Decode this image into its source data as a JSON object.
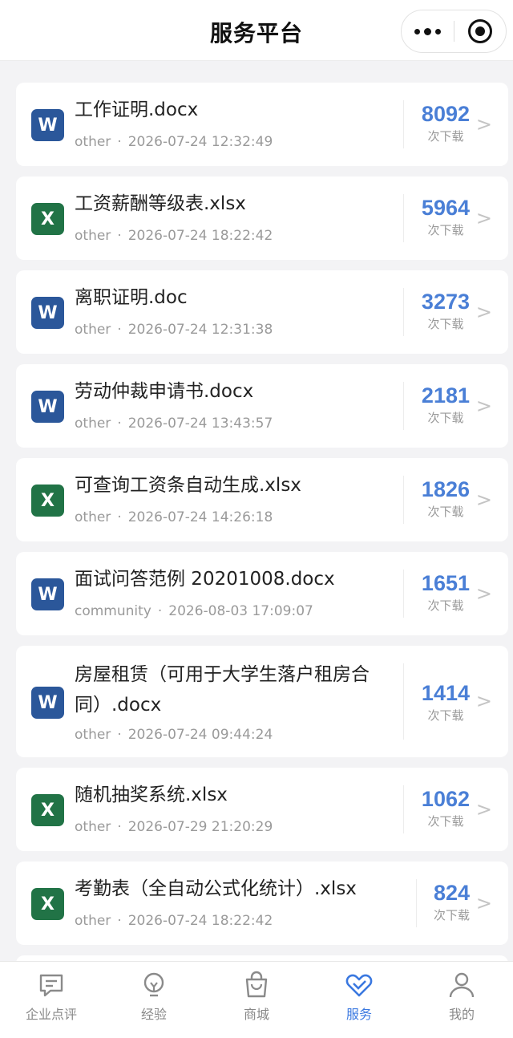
{
  "header": {
    "title": "服务平台"
  },
  "files": [
    {
      "type": "W",
      "name": "工作证明.docx",
      "source": "other",
      "datetime": "2026-07-24 12:32:49",
      "downloads": "8092"
    },
    {
      "type": "X",
      "name": "工资薪酬等级表.xlsx",
      "source": "other",
      "datetime": "2026-07-24 18:22:42",
      "downloads": "5964"
    },
    {
      "type": "W",
      "name": "离职证明.doc",
      "source": "other",
      "datetime": "2026-07-24 12:31:38",
      "downloads": "3273"
    },
    {
      "type": "W",
      "name": "劳动仲裁申请书.docx",
      "source": "other",
      "datetime": "2026-07-24 13:43:57",
      "downloads": "2181"
    },
    {
      "type": "X",
      "name": "可查询工资条自动生成.xlsx",
      "source": "other",
      "datetime": "2026-07-24 14:26:18",
      "downloads": "1826"
    },
    {
      "type": "W",
      "name": "面试问答范例 20201008.docx",
      "source": "community",
      "datetime": "2026-08-03 17:09:07",
      "downloads": "1651"
    },
    {
      "type": "W",
      "name": "房屋租赁（可用于大学生落户租房合同）.docx",
      "source": "other",
      "datetime": "2026-07-24 09:44:24",
      "downloads": "1414"
    },
    {
      "type": "X",
      "name": "随机抽奖系统.xlsx",
      "source": "other",
      "datetime": "2026-07-29 21:20:29",
      "downloads": "1062"
    },
    {
      "type": "X",
      "name": "考勤表（全自动公式化统计）.xlsx",
      "source": "other",
      "datetime": "2026-07-24 18:22:42",
      "downloads": "824"
    }
  ],
  "download_label": "次下载",
  "separator": "·",
  "chevron": ">",
  "colors": {
    "accent": "#4a7fd6",
    "word": "#2b579a",
    "excel": "#217346",
    "tab_active": "#3a78e0"
  },
  "tabbar": [
    {
      "label": "企业点评",
      "icon": "comment-icon",
      "active": false
    },
    {
      "label": "经验",
      "icon": "lightbulb-icon",
      "active": false
    },
    {
      "label": "商城",
      "icon": "shopping-bag-icon",
      "active": false
    },
    {
      "label": "服务",
      "icon": "heart-service-icon",
      "active": true
    },
    {
      "label": "我的",
      "icon": "user-icon",
      "active": false
    }
  ]
}
